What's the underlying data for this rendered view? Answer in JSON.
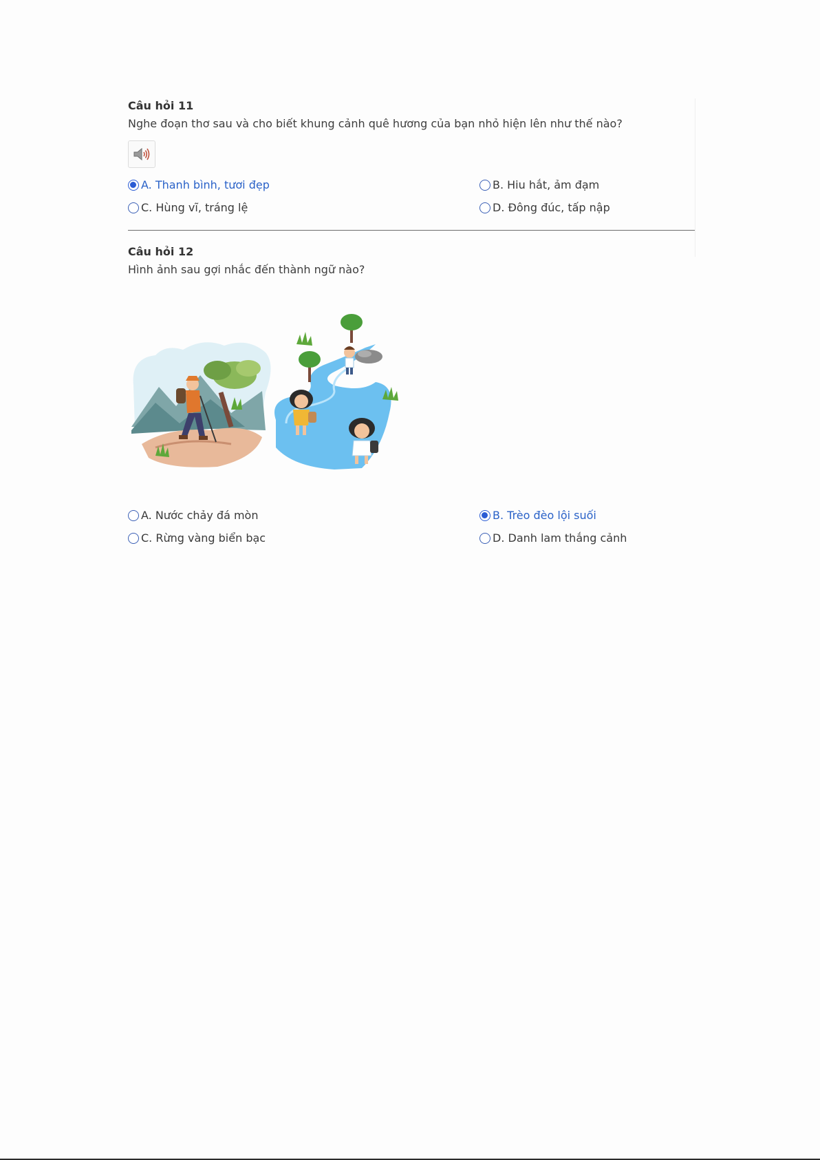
{
  "questions": [
    {
      "title": "Câu hỏi 11",
      "text": "Nghe đoạn thơ sau và cho biết khung cảnh quê hương của bạn nhỏ hiện lên như thế nào?",
      "media": "speaker-icon",
      "options": [
        {
          "text": "A. Thanh bình, tươi đẹp",
          "selected": true
        },
        {
          "text": "B. Hiu hắt, ảm đạm",
          "selected": false
        },
        {
          "text": "C. Hùng vĩ, tráng lệ",
          "selected": false
        },
        {
          "text": "D. Đông đúc, tấp nập",
          "selected": false
        }
      ]
    },
    {
      "title": "Câu hỏi 12",
      "text": "Hình ảnh sau gợi nhắc đến thành ngữ nào?",
      "media": "hiking-river-illustration",
      "options": [
        {
          "text": "A. Nước chảy đá mòn",
          "selected": false
        },
        {
          "text": "B. Trèo đèo lội suối",
          "selected": true
        },
        {
          "text": "C. Rừng vàng biển bạc",
          "selected": false
        },
        {
          "text": "D. Danh lam thắng cảnh",
          "selected": false
        }
      ]
    }
  ],
  "colors": {
    "selected": "#2a62c8",
    "text": "#3a3a3a",
    "divider": "#6b6b6b"
  }
}
